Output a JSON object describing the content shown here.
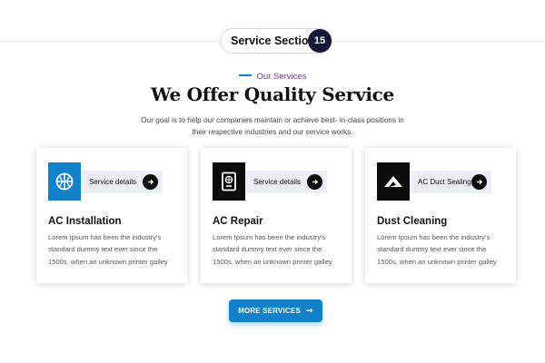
{
  "section": {
    "label": "Service Section",
    "number": "15"
  },
  "eyebrow": "Our Services",
  "heading": "We Offer Quality Service",
  "subtext": "Our goal is to help our companies maintain or achieve best- in-class positions in their respective industries and our service works.",
  "colors": {
    "accent": "#1381c9",
    "dark": "#0b0b0b",
    "badge": "#151837",
    "eyebrow": "#6b3a8c"
  },
  "cards": [
    {
      "icon": "basketball-icon",
      "detail_label": "Service details",
      "title": "AC Installation",
      "description": "Lorem Ipsum has been the industry's standard dummy text ever since the 1500s, when an unknown printer galley"
    },
    {
      "icon": "passport-icon",
      "detail_label": "Service details",
      "title": "AC Repair",
      "description": "Lorem Ipsum has been the industry's standard dummy text ever since the 1500s, when an unknown printer galley"
    },
    {
      "icon": "mountain-icon",
      "detail_label": "AC Duct Sealing",
      "title": "Dust Cleaning",
      "description": "Lorem Ipsum has been the industry's standard dummy text ever since the 1500s, when an unknown printer galley"
    }
  ],
  "more_button": {
    "label": "MORE SERVICES",
    "icon": "arrow-right-icon"
  }
}
